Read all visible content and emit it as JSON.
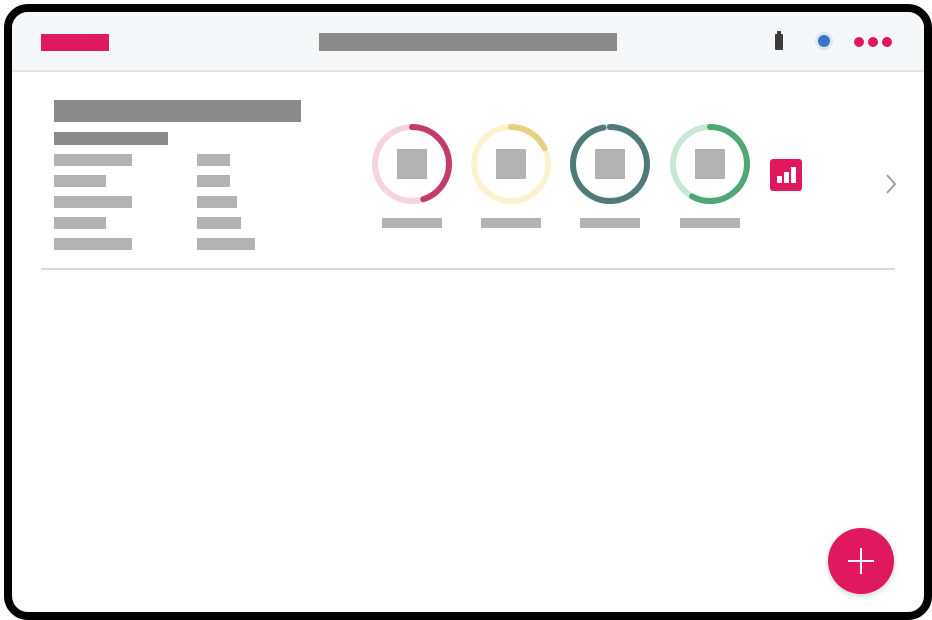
{
  "colors": {
    "brand": "#e0185e",
    "ring_track_1": "#f6d5de",
    "ring_arc_1": "#c43c6f",
    "ring_track_2": "#fbf3d0",
    "ring_arc_2": "#e6d17f",
    "ring_track_3": "#c7dbe3",
    "ring_arc_3": "#4f7a78",
    "ring_track_4": "#c8e8d7",
    "ring_arc_4": "#4fa776"
  },
  "icons": {
    "battery": "battery-icon",
    "status": "status-dot-icon",
    "more": "more-dots-icon",
    "chart": "bar-chart-icon",
    "next": "chevron-right-icon",
    "add": "plus-icon"
  },
  "rings": [
    {
      "progress": 0.45
    },
    {
      "progress": 0.18
    },
    {
      "progress": 0.97
    },
    {
      "progress": 0.58
    }
  ]
}
